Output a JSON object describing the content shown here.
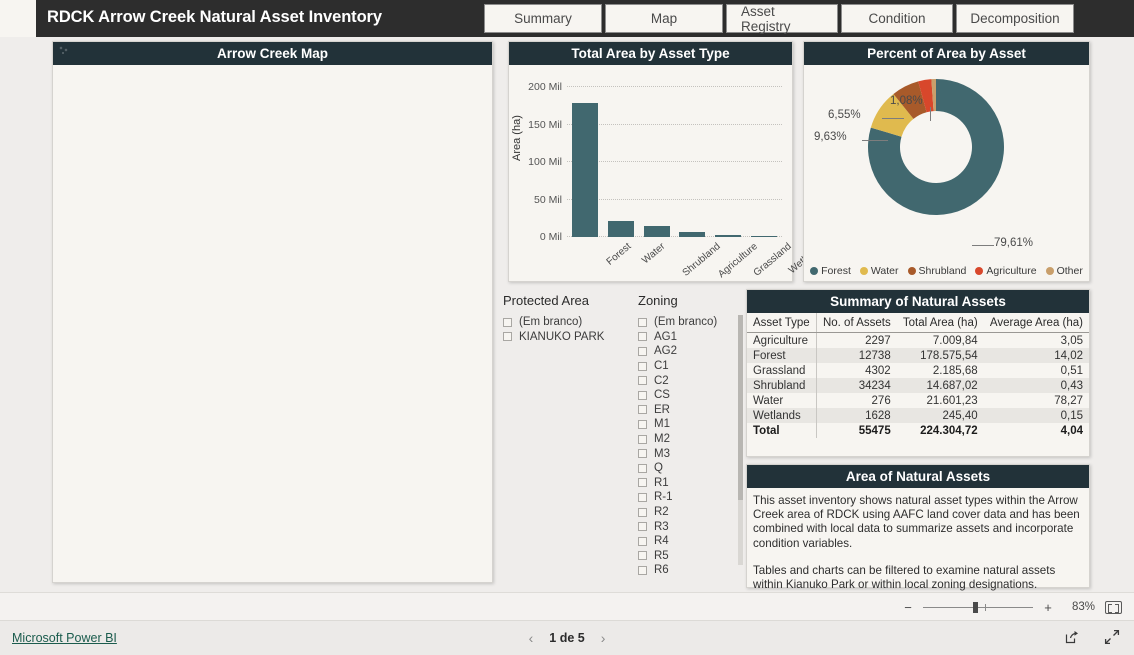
{
  "header": {
    "title": "RDCK Arrow Creek Natural Asset Inventory",
    "tabs": [
      {
        "label": "Summary"
      },
      {
        "label": "Map"
      },
      {
        "label": "Asset Registry"
      },
      {
        "label": "Condition"
      },
      {
        "label": "Decomposition"
      }
    ]
  },
  "map_card": {
    "title": "Arrow Creek Map"
  },
  "colors": {
    "header_bg": "#2d2d2d",
    "card_head_bg": "#223239",
    "canvas_bg": "#f7f5f1",
    "forest": "#41686f",
    "water": "#e0ba4e",
    "shrubland": "#a85a2a",
    "agriculture": "#d8472b",
    "other": "#c99f6b",
    "link": "#1b5c4d"
  },
  "chart_data": [
    {
      "type": "bar",
      "title": "Total Area by Asset Type",
      "xlabel": "",
      "ylabel": "Area (ha)",
      "categories": [
        "Forest",
        "Water",
        "Shrubland",
        "Agriculture",
        "Grassland",
        "Wetlands"
      ],
      "values": [
        178575.54,
        21601.23,
        14687.02,
        7009.84,
        2185.68,
        245.4
      ],
      "ylim": [
        0,
        200000
      ],
      "yticks": [
        0,
        50000,
        100000,
        150000,
        200000
      ],
      "ytick_labels": [
        "0 Mil",
        "50 Mil",
        "100 Mil",
        "150 Mil",
        "200 Mil"
      ],
      "grid": true,
      "bar_color": "#41686f"
    },
    {
      "type": "pie",
      "title": "Percent of Area by Asset",
      "donut": true,
      "legend_position": "bottom",
      "labels": [
        "Forest",
        "Water",
        "Shrubland",
        "Agriculture",
        "Other"
      ],
      "values": [
        79.61,
        9.63,
        6.55,
        3.13,
        1.08
      ],
      "display_labels": [
        "79,61%",
        "9,63%",
        "6,55%",
        "",
        "1,08%"
      ],
      "colors": [
        "#41686f",
        "#e0ba4e",
        "#a85a2a",
        "#d8472b",
        "#c99f6b"
      ],
      "annotations": [
        "79,61%",
        "9,63%",
        "6,55%",
        "1,08%"
      ]
    }
  ],
  "slicers": {
    "protected_area": {
      "title": "Protected Area",
      "items": [
        "(Em branco)",
        "KIANUKO PARK"
      ]
    },
    "zoning": {
      "title": "Zoning",
      "items": [
        "(Em branco)",
        "AG1",
        "AG2",
        "C1",
        "C2",
        "CS",
        "ER",
        "M1",
        "M2",
        "M3",
        "Q",
        "R1",
        "R-1",
        "R2",
        "R3",
        "R4",
        "R5",
        "R6"
      ]
    }
  },
  "summary_table": {
    "title": "Summary of Natural Assets",
    "columns": [
      "Asset Type",
      "No. of Assets",
      "Total Area (ha)",
      "Average Area (ha)"
    ],
    "rows": [
      {
        "asset_type": "Agriculture",
        "no_of_assets": "2297",
        "total_area": "7.009,84",
        "average_area": "3,05"
      },
      {
        "asset_type": "Forest",
        "no_of_assets": "12738",
        "total_area": "178.575,54",
        "average_area": "14,02"
      },
      {
        "asset_type": "Grassland",
        "no_of_assets": "4302",
        "total_area": "2.185,68",
        "average_area": "0,51"
      },
      {
        "asset_type": "Shrubland",
        "no_of_assets": "34234",
        "total_area": "14.687,02",
        "average_area": "0,43"
      },
      {
        "asset_type": "Water",
        "no_of_assets": "276",
        "total_area": "21.601,23",
        "average_area": "78,27"
      },
      {
        "asset_type": "Wetlands",
        "no_of_assets": "1628",
        "total_area": "245,40",
        "average_area": "0,15"
      }
    ],
    "total": {
      "asset_type": "Total",
      "no_of_assets": "55475",
      "total_area": "224.304,72",
      "average_area": "4,04"
    }
  },
  "description": {
    "title": "Area of Natural Assets",
    "paragraph1": "This asset inventory shows natural asset types within the Arrow Creek area of RDCK using AAFC land cover data and has been combined with local data to summarize assets and incorporate condition variables.",
    "paragraph2": "Tables and charts can be filtered to examine natural assets within Kianuko Park or within local zoning designations."
  },
  "zoom_bar": {
    "minus": "−",
    "plus": "+",
    "percent": "83%",
    "fit_label": "fit-to-page-icon"
  },
  "footer": {
    "brand": "Microsoft Power BI",
    "prev": "‹",
    "next": "›",
    "page_label": "1 de 5",
    "share_icon": "share-icon",
    "fullscreen_icon": "fullscreen-icon"
  }
}
